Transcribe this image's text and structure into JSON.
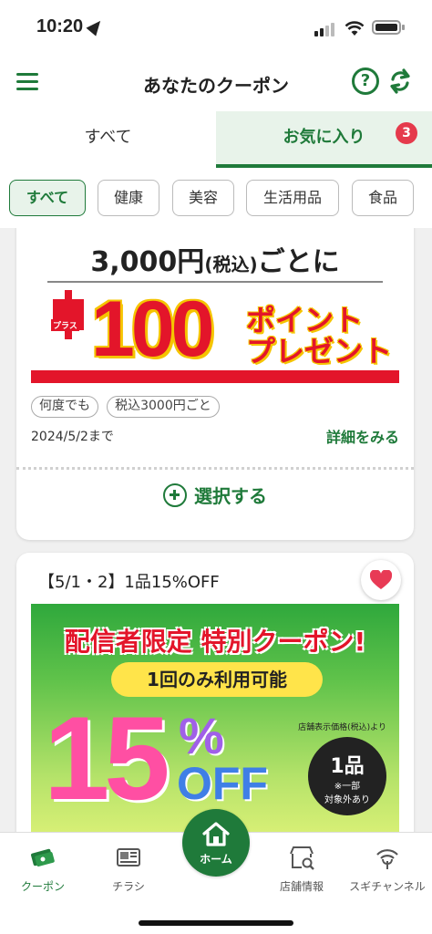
{
  "status": {
    "time": "10:20"
  },
  "header": {
    "title": "あなたのクーポン",
    "help": "?"
  },
  "tabs": [
    {
      "label": "すべて"
    },
    {
      "label": "お気に入り"
    }
  ],
  "favorites_badge": "3",
  "filters": [
    "すべて",
    "健康",
    "美容",
    "生活用品",
    "食品"
  ],
  "coupon1": {
    "banner_top": "3,000円",
    "banner_top_tax": "(税込)",
    "banner_top_suffix": "ごとに",
    "plus_label": "プラス",
    "banner_number": "100",
    "banner_points": "ポイント",
    "banner_present": "プレゼント",
    "tags": [
      "何度でも",
      "税込3000円ごと"
    ],
    "until": "2024/5/2まで",
    "details": "詳細をみる",
    "select": "選択する"
  },
  "coupon2": {
    "title": "【5/1・2】1品15%OFF",
    "banner_head": "配信者限定 特別クーポン!",
    "banner_pill": "1回のみ利用可能",
    "banner_big": "15",
    "banner_pct": "%",
    "banner_off": "OFF",
    "banner_note": "店舗表示価格(税込)より",
    "circle_main": "1品",
    "circle_sub1": "※一部",
    "circle_sub2": "対象外あり"
  },
  "bottom_nav": [
    {
      "label": "クーポン"
    },
    {
      "label": "チラシ"
    },
    {
      "label": "ホーム"
    },
    {
      "label": "店舗情報"
    },
    {
      "label": "スギチャンネル"
    }
  ],
  "colors": {
    "brand_green": "#1f7a3a",
    "badge_red": "#e53a4c",
    "heart_red": "#e83a55"
  }
}
